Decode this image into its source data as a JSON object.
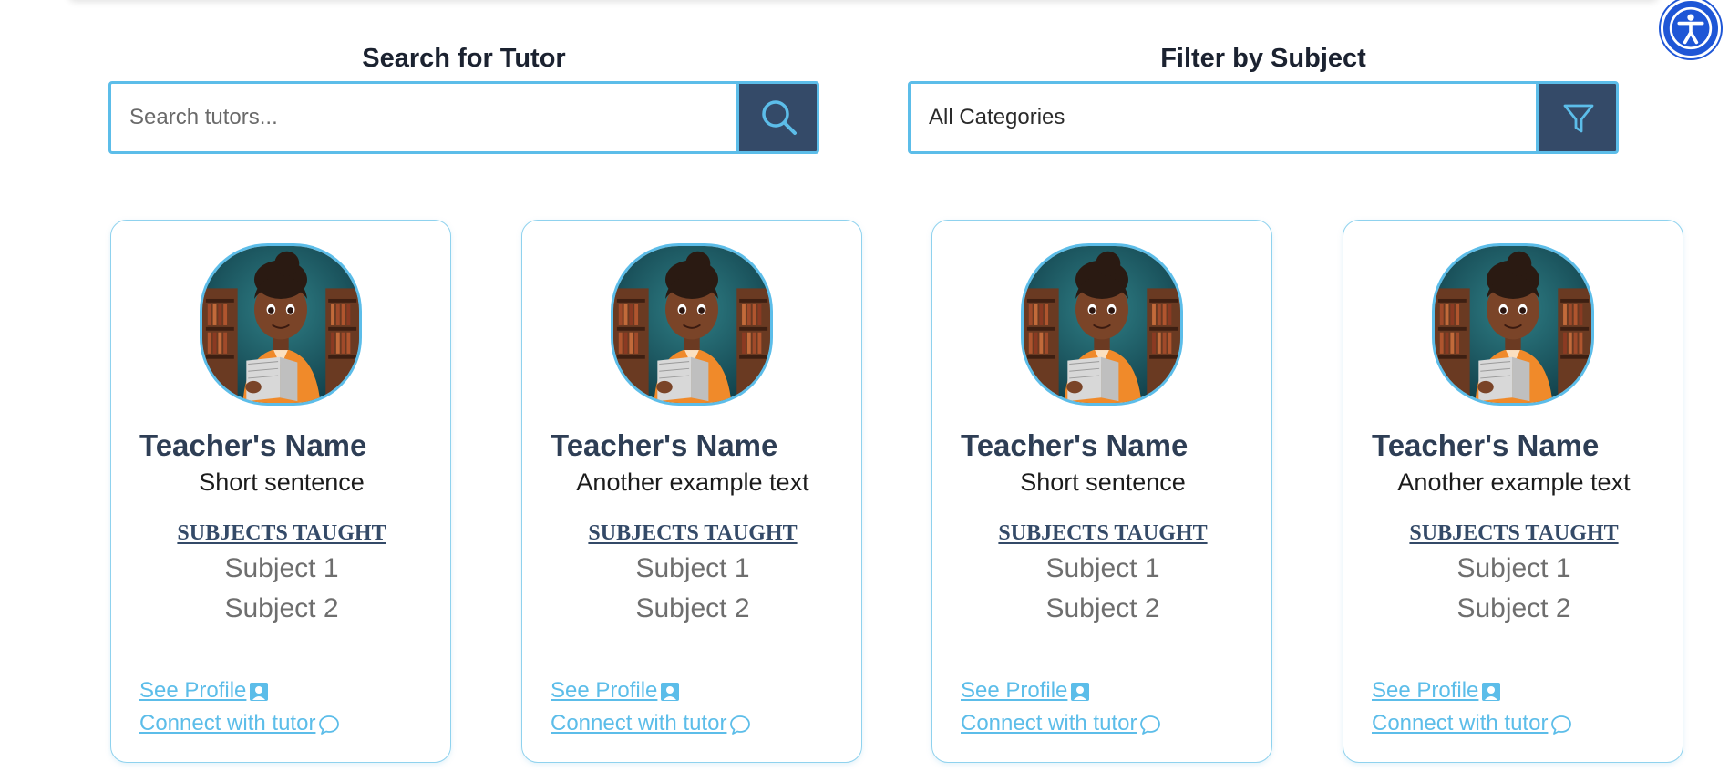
{
  "accessibility": {
    "icon": "accessibility-icon",
    "color": "#1e56d6"
  },
  "search": {
    "label": "Search for Tutor",
    "placeholder": "Search tutors...",
    "button_icon": "search-icon"
  },
  "subject_filter": {
    "label": "Filter by Subject",
    "selected": "All Categories",
    "button_icon": "filter-icon"
  },
  "colors": {
    "accent": "#5cbde9",
    "button_bg": "#344a68",
    "name": "#2e3e55",
    "subject": "#6e6e6e"
  },
  "cards": [
    {
      "name": "Teacher's Name",
      "tagline": "Short sentence",
      "subjects_heading": "SUBJECTS TAUGHT",
      "subjects": [
        "Subject 1",
        "Subject 2"
      ],
      "profile_link": "See Profile",
      "connect_link": "Connect with tutor"
    },
    {
      "name": "Teacher's Name",
      "tagline": "Another example text",
      "subjects_heading": "SUBJECTS TAUGHT",
      "subjects": [
        "Subject 1",
        "Subject 2"
      ],
      "profile_link": "See Profile",
      "connect_link": "Connect with tutor"
    },
    {
      "name": "Teacher's Name",
      "tagline": "Short sentence",
      "subjects_heading": "SUBJECTS TAUGHT",
      "subjects": [
        "Subject 1",
        "Subject 2"
      ],
      "profile_link": "See Profile",
      "connect_link": "Connect with tutor"
    },
    {
      "name": "Teacher's Name",
      "tagline": "Another example text",
      "subjects_heading": "SUBJECTS TAUGHT",
      "subjects": [
        "Subject 1",
        "Subject 2"
      ],
      "profile_link": "See Profile",
      "connect_link": "Connect with tutor"
    }
  ]
}
